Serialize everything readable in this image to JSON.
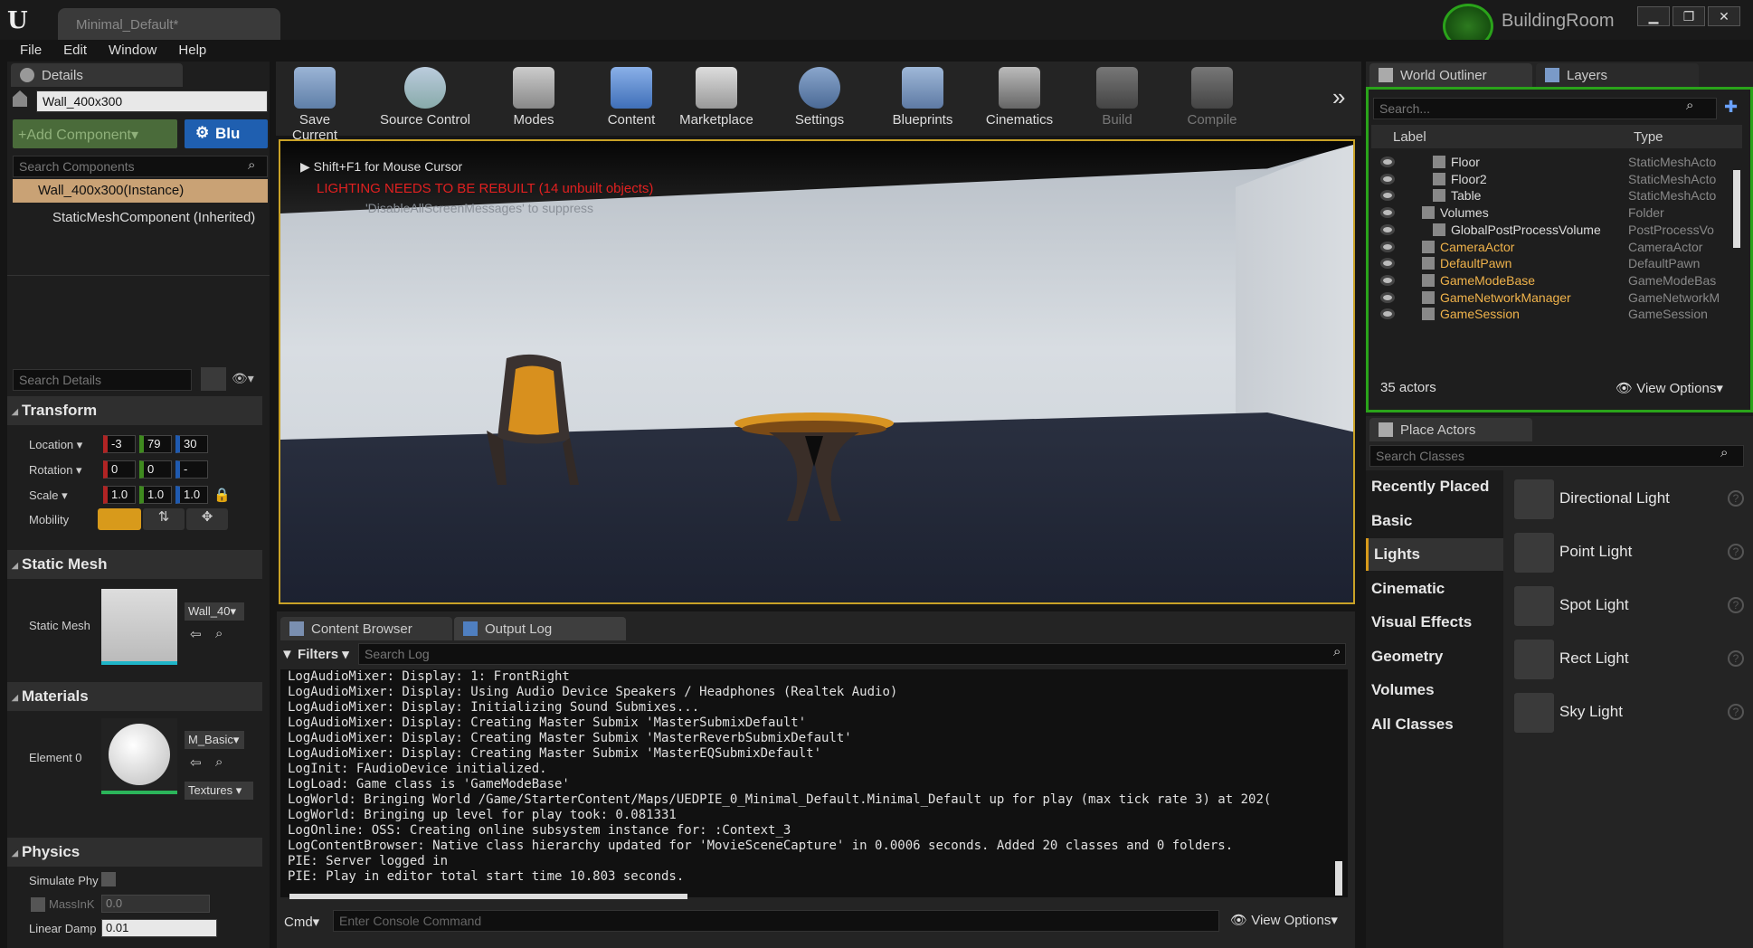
{
  "window": {
    "doc_tab": "Minimal_Default*",
    "project": "BuildingRoom",
    "controls": [
      "▁",
      "❐",
      "✕"
    ]
  },
  "menu": [
    "File",
    "Edit",
    "Window",
    "Help"
  ],
  "details": {
    "tab": "Details",
    "actor_name": "Wall_400x300",
    "add_component": "+Add Component▾",
    "blueprint_btn": "Blu",
    "search_components": "Search Components",
    "components": [
      "Wall_400x300(Instance)",
      "StaticMeshComponent (Inherited)"
    ],
    "search_details": "Search Details",
    "transform": {
      "title": "Transform",
      "location_label": "Location ▾",
      "rotation_label": "Rotation ▾",
      "scale_label": "Scale ▾",
      "mobility_label": "Mobility",
      "location": [
        "-3",
        "79",
        "30"
      ],
      "rotation": [
        "0",
        "0",
        "-"
      ],
      "scale": [
        "1.0",
        "1.0",
        "1.0"
      ]
    },
    "static_mesh": {
      "title": "Static Mesh",
      "label": "Static Mesh",
      "asset": "Wall_40▾"
    },
    "materials": {
      "title": "Materials",
      "label": "Element 0",
      "asset": "M_Basic▾",
      "textures": "Textures ▾"
    },
    "physics": {
      "title": "Physics",
      "simulate": "Simulate Phy",
      "mass": "MassInK",
      "mass_value": "0.0",
      "linear_damp": "Linear Damp",
      "linear_damp_value": "0.01"
    }
  },
  "toolbar": [
    {
      "label": "Save Current",
      "icon": "save-icon"
    },
    {
      "label": "Source Control",
      "icon": "source-control-icon"
    },
    {
      "label": "Modes",
      "icon": "modes-icon"
    },
    {
      "label": "Content",
      "icon": "content-icon"
    },
    {
      "label": "Marketplace",
      "icon": "marketplace-icon"
    },
    {
      "label": "Settings",
      "icon": "settings-icon"
    },
    {
      "label": "Blueprints",
      "icon": "blueprints-icon"
    },
    {
      "label": "Cinematics",
      "icon": "cinematics-icon"
    },
    {
      "label": "Build",
      "icon": "build-icon"
    },
    {
      "label": "Compile",
      "icon": "compile-icon"
    }
  ],
  "viewport": {
    "hint": "Shift+F1 for Mouse Cursor",
    "warning": "LIGHTING NEEDS TO BE REBUILT (14 unbuilt objects)",
    "suppress": "'DisableAllScreenMessages' to suppress"
  },
  "bottom": {
    "tabs": [
      "Content Browser",
      "Output Log"
    ],
    "filters": "Filters ▾",
    "search_log": "Search Log",
    "log": [
      "LogAudioMixer: Display: 1: FrontRight",
      "LogAudioMixer: Display: Using Audio Device Speakers / Headphones (Realtek Audio)",
      "LogAudioMixer: Display: Initializing Sound Submixes...",
      "LogAudioMixer: Display: Creating Master Submix 'MasterSubmixDefault'",
      "LogAudioMixer: Display: Creating Master Submix 'MasterReverbSubmixDefault'",
      "LogAudioMixer: Display: Creating Master Submix 'MasterEQSubmixDefault'",
      "LogInit: FAudioDevice initialized.",
      "LogLoad: Game class is 'GameModeBase'",
      "LogWorld: Bringing World /Game/StarterContent/Maps/UEDPIE_0_Minimal_Default.Minimal_Default up for play (max tick rate 3) at 202(",
      "LogWorld: Bringing up level for play took: 0.081331",
      "LogOnline: OSS: Creating online subsystem instance for: :Context_3",
      "LogContentBrowser: Native class hierarchy updated for 'MovieSceneCapture' in 0.0006 seconds. Added 20 classes and 0 folders.",
      "PIE: Server logged in",
      "PIE: Play in editor total start time 10.803 seconds."
    ],
    "cmd": "Cmd▾",
    "console_placeholder": "Enter Console Command",
    "view_options": "View Options▾"
  },
  "outliner": {
    "tab": "World Outliner",
    "layers_tab": "Layers",
    "search": "Search...",
    "col_label": "Label",
    "col_type": "Type",
    "rows": [
      {
        "name": "Floor",
        "type": "StaticMeshActo",
        "indent": 2,
        "hl": false
      },
      {
        "name": "Floor2",
        "type": "StaticMeshActo",
        "indent": 2,
        "hl": false
      },
      {
        "name": "Table",
        "type": "StaticMeshActo",
        "indent": 2,
        "hl": false
      },
      {
        "name": "Volumes",
        "type": "Folder",
        "indent": 1,
        "hl": false
      },
      {
        "name": "GlobalPostProcessVolume",
        "type": "PostProcessVo",
        "indent": 2,
        "hl": false
      },
      {
        "name": "CameraActor",
        "type": "CameraActor",
        "indent": 1,
        "hl": true
      },
      {
        "name": "DefaultPawn",
        "type": "DefaultPawn",
        "indent": 1,
        "hl": true
      },
      {
        "name": "GameModeBase",
        "type": "GameModeBas",
        "indent": 1,
        "hl": true
      },
      {
        "name": "GameNetworkManager",
        "type": "GameNetworkM",
        "indent": 1,
        "hl": true
      },
      {
        "name": "GameSession",
        "type": "GameSession",
        "indent": 1,
        "hl": true
      }
    ],
    "count": "35 actors",
    "view_options": "View Options▾"
  },
  "place_actors": {
    "tab": "Place Actors",
    "search": "Search Classes",
    "categories": [
      "Recently Placed",
      "Basic",
      "Lights",
      "Cinematic",
      "Visual Effects",
      "Geometry",
      "Volumes",
      "All Classes"
    ],
    "selected": "Lights",
    "items": [
      "Directional Light",
      "Point Light",
      "Spot Light",
      "Rect Light",
      "Sky Light"
    ]
  },
  "colors": {
    "accent": "#c9a227",
    "selection": "#d89a1b",
    "link": "#f0b34b",
    "warning": "#e02020"
  }
}
